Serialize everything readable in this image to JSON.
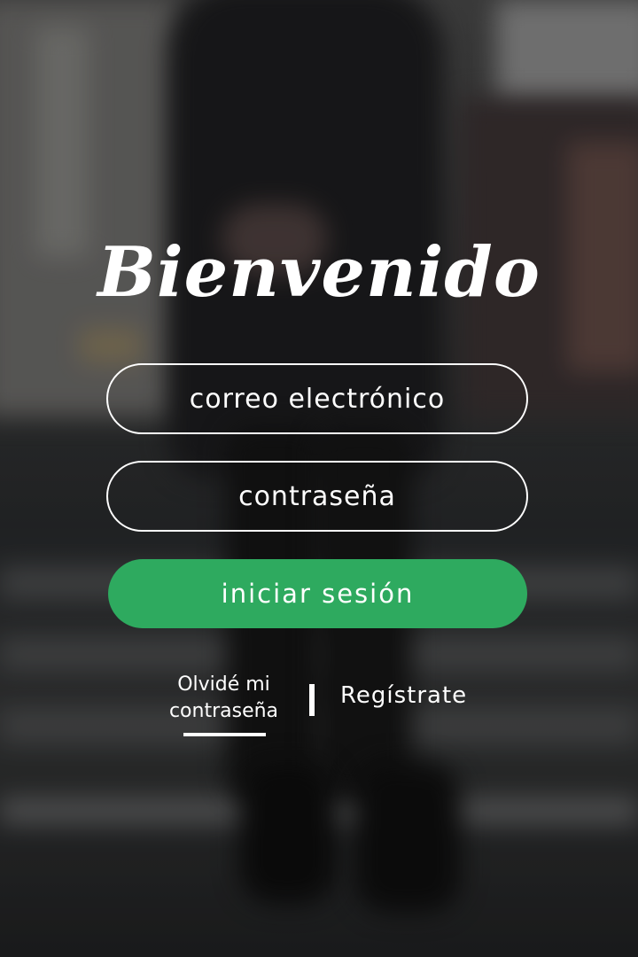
{
  "login": {
    "title": "Bienvenido",
    "email_placeholder": "correo electrónico",
    "password_placeholder": "contraseña",
    "submit_label": "iniciar sesión",
    "forgot_password_label": "Olvidé mi contraseña",
    "register_label": "Regístrate"
  },
  "colors": {
    "accent": "#2eaa5f",
    "text": "#ffffff"
  }
}
